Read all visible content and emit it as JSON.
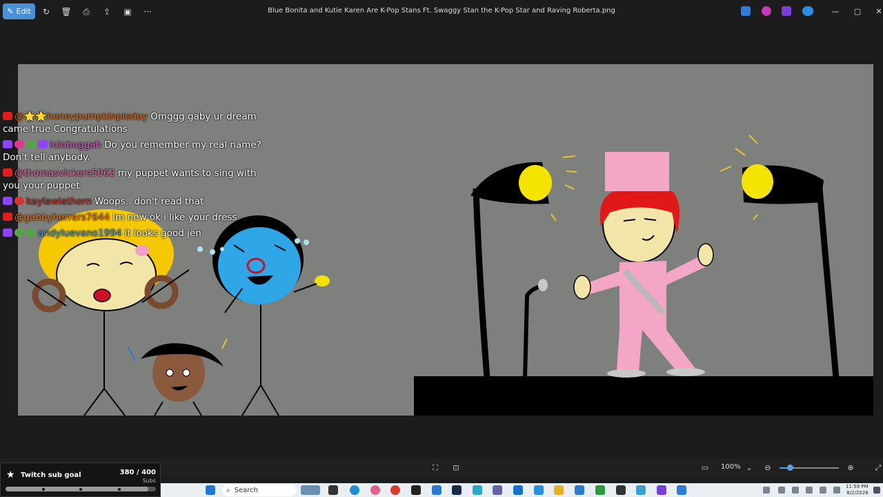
{
  "toolbar": {
    "edit_label": "Edit",
    "title": "Blue Bonita and Kutie Karen Are K-Pop Stans Ft. Swaggy Stan the K-Pop Star and Raving Roberta.png",
    "more_label": "···"
  },
  "chat": [
    {
      "platform": "youtube",
      "user": "@🌟🌟honeypumpkinpieday",
      "user_color": "#e06a1e",
      "message": "Omggg gaby ur dream came true Congratulations"
    },
    {
      "platform": "twitch",
      "user": "lolobuggah",
      "user_color": "#e25ad1",
      "message": "Do you remember my real name? Don't tell anybody."
    },
    {
      "platform": "youtube",
      "user": "@thomasvickers5062",
      "user_color": "#e66aa6",
      "message": "my puppet wants to sing with you your puppet"
    },
    {
      "platform": "twitch",
      "user": "kaylawiethorn",
      "user_color": "#d8342a",
      "message": "Woops.. don't read that"
    },
    {
      "platform": "youtube",
      "user": "@gabbyherrers7644",
      "user_color": "#f07c1c",
      "message": "Im new ok i like your dress"
    },
    {
      "platform": "twitch",
      "user": "andyluevano1994",
      "user_color": "#4a9fe8",
      "message": "it looks good jen"
    }
  ],
  "statusbar": {
    "zoom_value": "100%",
    "zoom_fraction": 0.18
  },
  "subgoal": {
    "title": "Twitch sub goal",
    "count": "380 / 400",
    "unit": "Subs",
    "progress": 0.95
  },
  "taskbar": {
    "search_placeholder": "Search",
    "time": "11:59 PM",
    "date": "8/2/2026"
  },
  "colors": {
    "accent": "#4a90d9",
    "canvas": "#7d807d",
    "stage": "#000000",
    "spotlight": "#f5e400",
    "pink_suit": "#f4a6c6"
  }
}
